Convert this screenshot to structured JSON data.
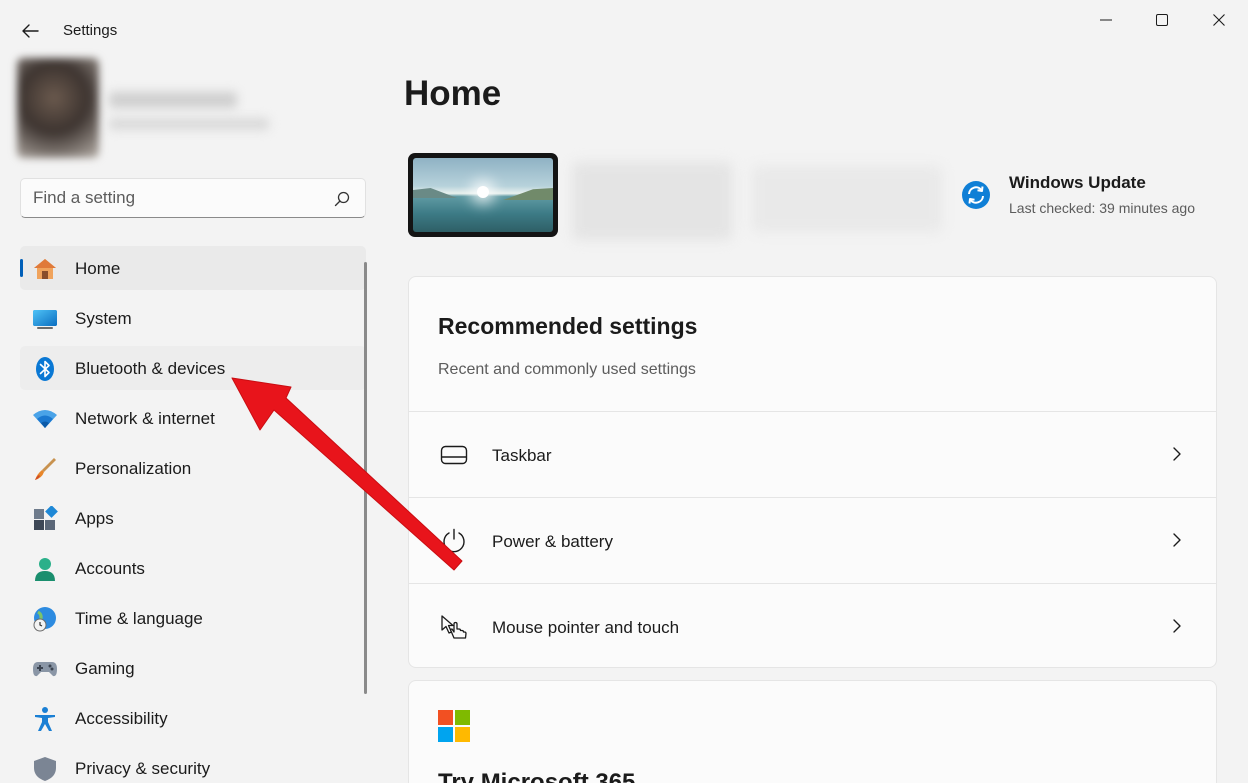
{
  "window": {
    "title": "Settings"
  },
  "search": {
    "placeholder": "Find a setting",
    "value": ""
  },
  "nav": {
    "items": [
      {
        "label": "Home",
        "icon": "home-icon",
        "selected": true
      },
      {
        "label": "System",
        "icon": "system-icon"
      },
      {
        "label": "Bluetooth & devices",
        "icon": "bluetooth-icon",
        "highlighted": true
      },
      {
        "label": "Network & internet",
        "icon": "wifi-icon"
      },
      {
        "label": "Personalization",
        "icon": "brush-icon"
      },
      {
        "label": "Apps",
        "icon": "apps-icon"
      },
      {
        "label": "Accounts",
        "icon": "accounts-icon"
      },
      {
        "label": "Time & language",
        "icon": "globe-clock-icon"
      },
      {
        "label": "Gaming",
        "icon": "gamepad-icon"
      },
      {
        "label": "Accessibility",
        "icon": "accessibility-icon"
      },
      {
        "label": "Privacy & security",
        "icon": "shield-icon"
      }
    ]
  },
  "main": {
    "page_title": "Home",
    "windows_update": {
      "title": "Windows Update",
      "subtitle": "Last checked: 39 minutes ago"
    },
    "recommended": {
      "title": "Recommended settings",
      "subtitle": "Recent and commonly used settings",
      "rows": [
        {
          "label": "Taskbar",
          "icon": "taskbar-icon"
        },
        {
          "label": "Power & battery",
          "icon": "power-icon"
        },
        {
          "label": "Mouse pointer and touch",
          "icon": "pointer-touch-icon"
        }
      ]
    },
    "microsoft365": {
      "title": "Try Microsoft 365"
    }
  },
  "colors": {
    "accent": "#005fb8",
    "annotation_arrow": "#e8141b"
  }
}
